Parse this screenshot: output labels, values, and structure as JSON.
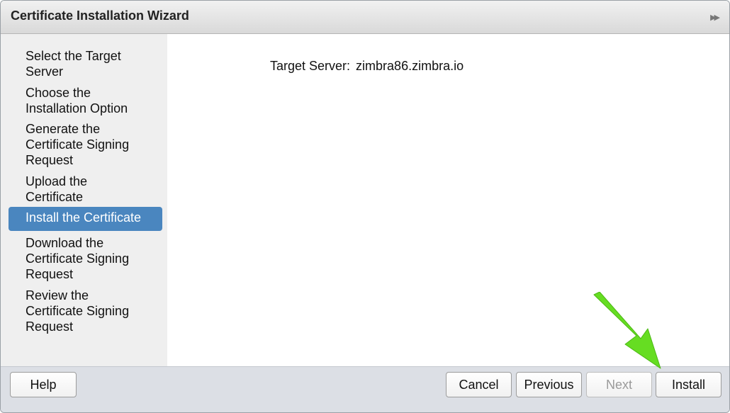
{
  "window": {
    "title": "Certificate Installation Wizard",
    "expand_icon": "double-chevron-right-icon"
  },
  "sidebar": {
    "steps": [
      {
        "lines": [
          "Select the Target",
          "Server"
        ]
      },
      {
        "lines": [
          "Choose the",
          "Installation Option"
        ]
      },
      {
        "lines": [
          "Generate the",
          "Certificate Signing",
          "Request"
        ]
      },
      {
        "lines": [
          "Upload the",
          "Certificate"
        ]
      },
      {
        "lines": [
          "Install the Certificate"
        ],
        "active": true
      },
      {
        "lines": [
          "Download the",
          "Certificate Signing",
          "Request"
        ]
      },
      {
        "lines": [
          "Review the",
          "Certificate Signing",
          "Request"
        ]
      }
    ],
    "active_color": "#4a86bf"
  },
  "main": {
    "target_server_label": "Target Server:",
    "target_server_value": "zimbra86.zimbra.io"
  },
  "footer": {
    "help_label": "Help",
    "cancel_label": "Cancel",
    "previous_label": "Previous",
    "next_label": "Next",
    "install_label": "Install",
    "next_disabled": true
  },
  "annotation": {
    "arrow_color": "#66dd22",
    "arrow_icon": "green-pointer-arrow-icon"
  }
}
